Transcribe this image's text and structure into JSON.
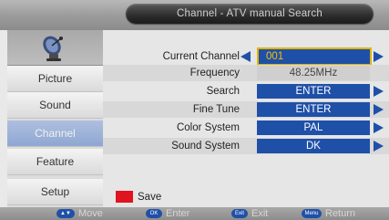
{
  "title": "Channel - ATV manual Search",
  "sidebar": {
    "items": [
      {
        "label": "Picture"
      },
      {
        "label": "Sound"
      },
      {
        "label": "Channel"
      },
      {
        "label": "Feature"
      },
      {
        "label": "Setup"
      }
    ],
    "active": "Channel"
  },
  "settings": {
    "current_channel": {
      "label": "Current Channel",
      "value": "001"
    },
    "frequency": {
      "label": "Frequency",
      "value": "48.25MHz"
    },
    "search": {
      "label": "Search",
      "value": "ENTER"
    },
    "fine_tune": {
      "label": "Fine Tune",
      "value": "ENTER"
    },
    "color_system": {
      "label": "Color System",
      "value": "PAL"
    },
    "sound_system": {
      "label": "Sound System",
      "value": "DK"
    }
  },
  "save": {
    "label": "Save",
    "color": "#e0141e"
  },
  "footer": {
    "move": {
      "key": "▲▼",
      "label": "Move"
    },
    "enter": {
      "key": "OK",
      "label": "Enter"
    },
    "exit": {
      "key": "Exit",
      "label": "Exit"
    },
    "return": {
      "key": "Menu",
      "label": "Return"
    }
  },
  "colors": {
    "accent": "#1f50a8",
    "highlight": "#e0b400",
    "active_tab": "#9db1d8"
  }
}
